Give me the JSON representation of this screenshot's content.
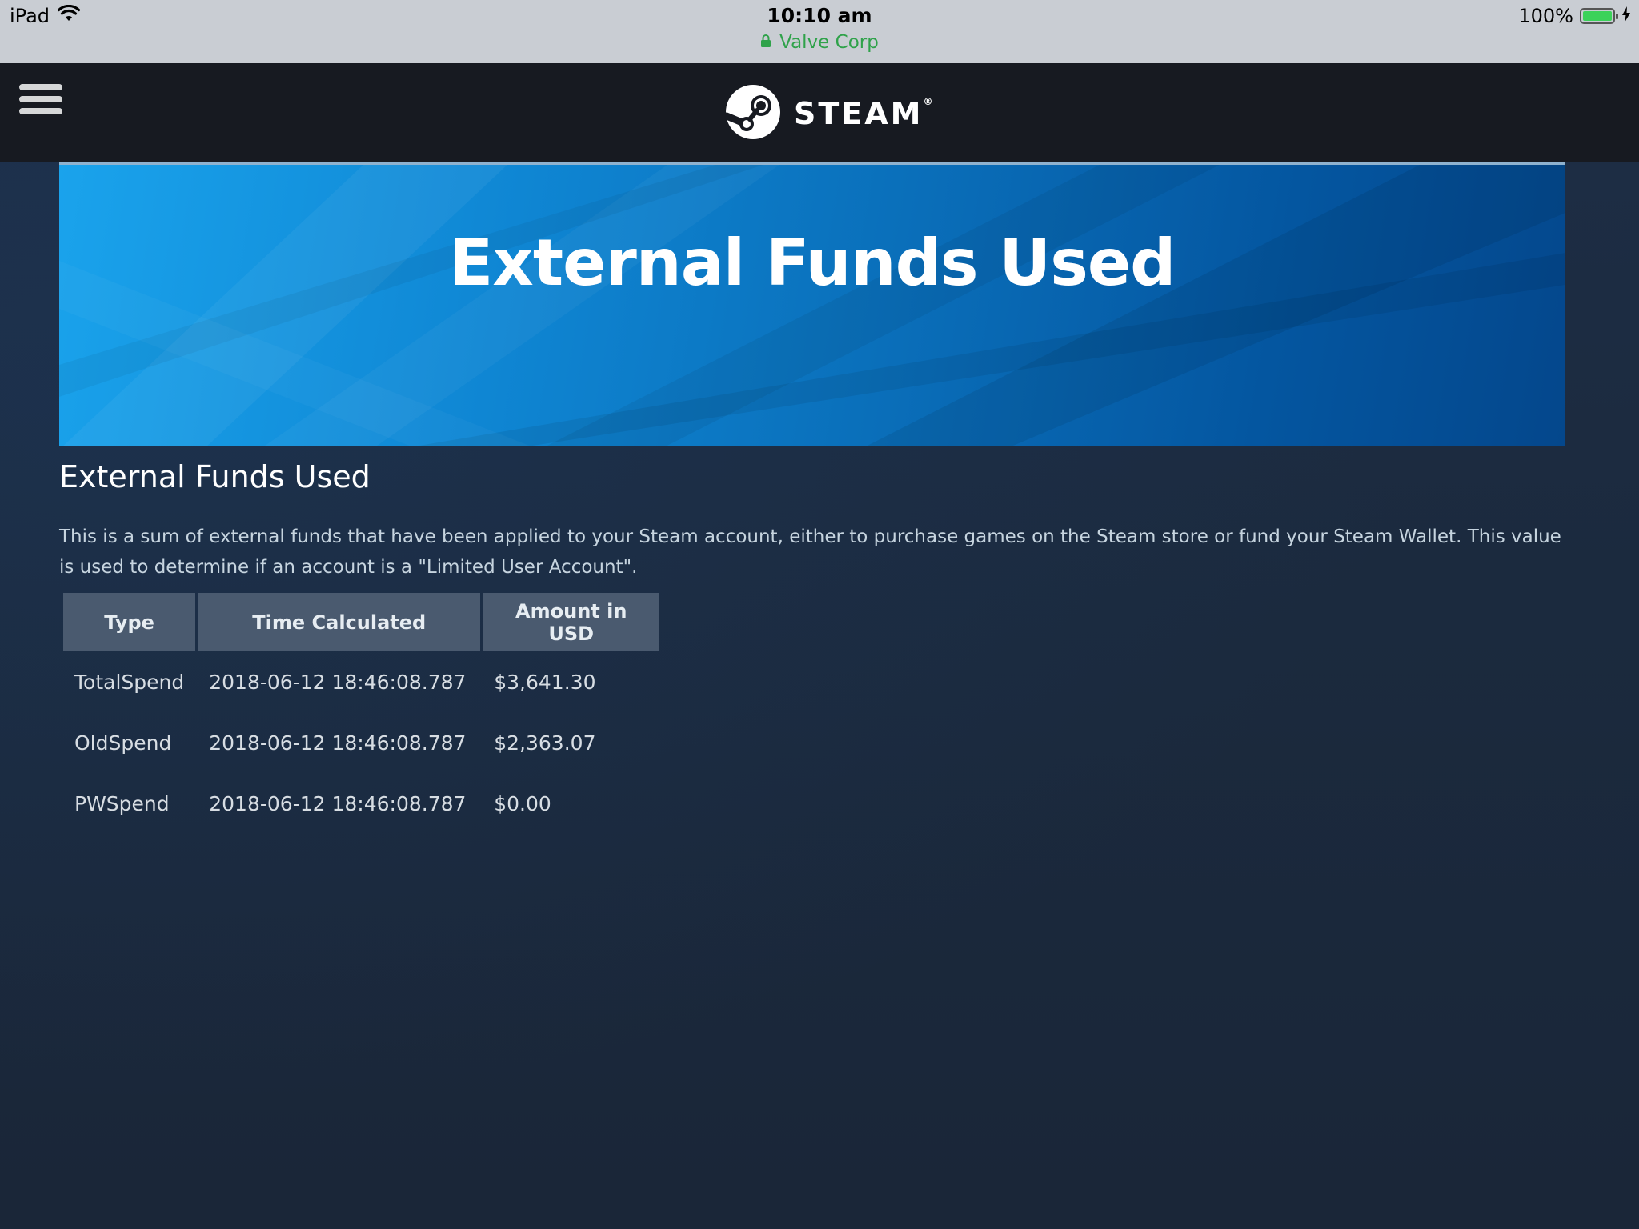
{
  "status_bar": {
    "device": "iPad",
    "time": "10:10 am",
    "site": "Valve Corp",
    "battery": "100%"
  },
  "header": {
    "brand": "STEAM"
  },
  "hero": {
    "title": "External Funds Used"
  },
  "content": {
    "section_title": "External Funds Used",
    "description": "This is a sum of external funds that have been applied to your Steam account, either to purchase games on the Steam store or fund your Steam Wallet. This value is used to determine if an account is a \"Limited User Account\"."
  },
  "table": {
    "headers": [
      "Type",
      "Time Calculated",
      "Amount in USD"
    ],
    "rows": [
      [
        "TotalSpend",
        "2018-06-12 18:46:08.787",
        "$3,641.30"
      ],
      [
        "OldSpend",
        "2018-06-12 18:46:08.787",
        "$2,363.07"
      ],
      [
        "PWSpend",
        "2018-06-12 18:46:08.787",
        "$0.00"
      ]
    ]
  },
  "colors": {
    "status_bar_bg": "#c9cdd3",
    "nav_bg": "#171a21",
    "page_bg": "#1b2838",
    "hero_blue": "#1aa3ec",
    "table_header_bg": "#4a5a6f",
    "secure_green": "#2fa24a"
  },
  "icons": [
    "wifi-icon",
    "lock-icon",
    "battery-icon",
    "charging-bolt-icon",
    "hamburger-menu-icon",
    "steam-logo-icon"
  ]
}
